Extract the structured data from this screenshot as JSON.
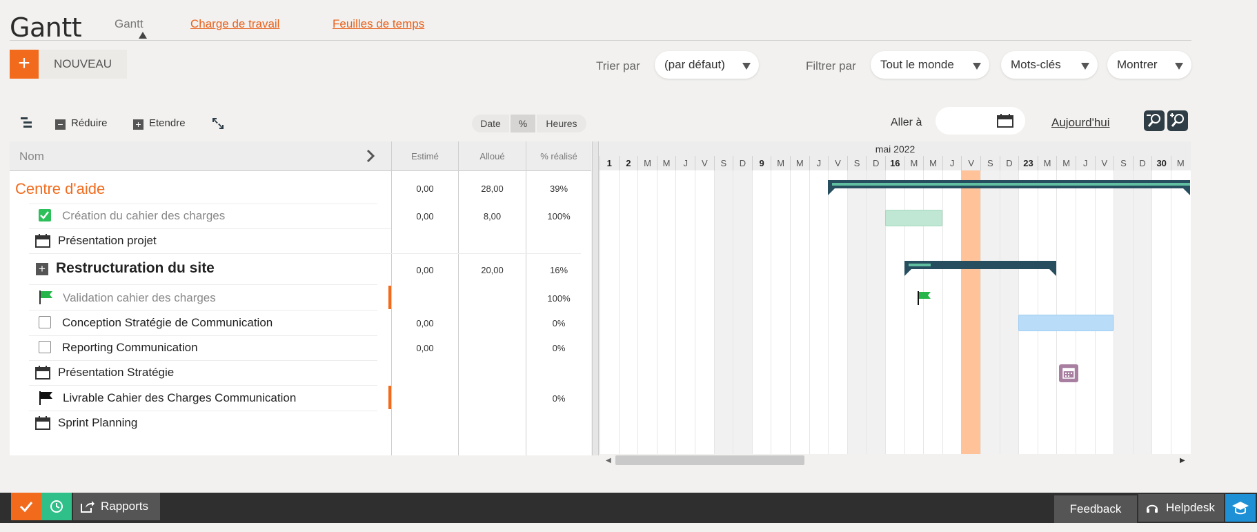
{
  "header": {
    "title": "Gantt",
    "tabs": [
      {
        "label": "Gantt"
      },
      {
        "label": "Charge de travail"
      },
      {
        "label": "Feuilles de temps"
      }
    ]
  },
  "actions": {
    "new_plus": "+",
    "new_label": "NOUVEAU"
  },
  "sort": {
    "label": "Trier par",
    "value": "(par défaut)"
  },
  "filter": {
    "label": "Filtrer par",
    "who": "Tout le monde",
    "keywords": "Mots-clés",
    "show": "Montrer"
  },
  "toolbar": {
    "reduce": "Réduire",
    "expand": "Etendre",
    "seg": [
      "Date",
      "%",
      "Heures"
    ],
    "goto": "Aller à",
    "today": "Aujourd'hui"
  },
  "columns": {
    "name": "Nom",
    "estimated": "Estimé",
    "allocated": "Alloué",
    "done": "% réalisé"
  },
  "rows": [
    {
      "name": "Centre d'aide",
      "estimated": "0,00",
      "allocated": "28,00",
      "done": "39%"
    },
    {
      "name": "Création du cahier des charges",
      "estimated": "0,00",
      "allocated": "8,00",
      "done": "100%"
    },
    {
      "name": "Présentation projet",
      "estimated": "",
      "allocated": "",
      "done": ""
    },
    {
      "name": "Restructuration du site",
      "estimated": "0,00",
      "allocated": "20,00",
      "done": "16%"
    },
    {
      "name": "Validation cahier des charges",
      "estimated": "",
      "allocated": "",
      "done": "100%"
    },
    {
      "name": "Conception Stratégie de Communication",
      "estimated": "0,00",
      "allocated": "",
      "done": "0%"
    },
    {
      "name": "Reporting Communication",
      "estimated": "0,00",
      "allocated": "",
      "done": "0%"
    },
    {
      "name": "Présentation Stratégie",
      "estimated": "",
      "allocated": "",
      "done": ""
    },
    {
      "name": "Livrable Cahier des Charges Communication",
      "estimated": "",
      "allocated": "",
      "done": "0%"
    },
    {
      "name": "Sprint Planning",
      "estimated": "",
      "allocated": "",
      "done": ""
    }
  ],
  "gantt": {
    "month": "mai 2022",
    "days": [
      "1",
      "2",
      "M",
      "M",
      "J",
      "V",
      "S",
      "D",
      "9",
      "M",
      "M",
      "J",
      "V",
      "S",
      "D",
      "16",
      "M",
      "M",
      "J",
      "V",
      "S",
      "D",
      "23",
      "M",
      "M",
      "J",
      "V",
      "S",
      "D",
      "30",
      "M"
    ],
    "bold_days": [
      0,
      1,
      8,
      15,
      22,
      29
    ],
    "today_index": 19,
    "colors": {
      "summary": "#274e5e",
      "done": "#bfe7d3",
      "planned": "#b9dcf8",
      "today": "#ffc299",
      "milestone": "#25b54a",
      "event": "#a87fa0"
    },
    "bars": [
      {
        "row": 0,
        "kind": "summary",
        "start": 12,
        "end": 31
      },
      {
        "row": 1,
        "kind": "done",
        "start": 15,
        "end": 18
      },
      {
        "row": 3,
        "kind": "summary",
        "start": 16,
        "end": 24
      },
      {
        "row": 4,
        "kind": "milestone",
        "start": 16.7,
        "end": 16.7
      },
      {
        "row": 5,
        "kind": "planned",
        "start": 22,
        "end": 27
      },
      {
        "row": 7,
        "kind": "event",
        "start": 24,
        "end": 25
      }
    ]
  },
  "bottom": {
    "reports": "Rapports",
    "feedback": "Feedback",
    "helpdesk": "Helpdesk"
  }
}
